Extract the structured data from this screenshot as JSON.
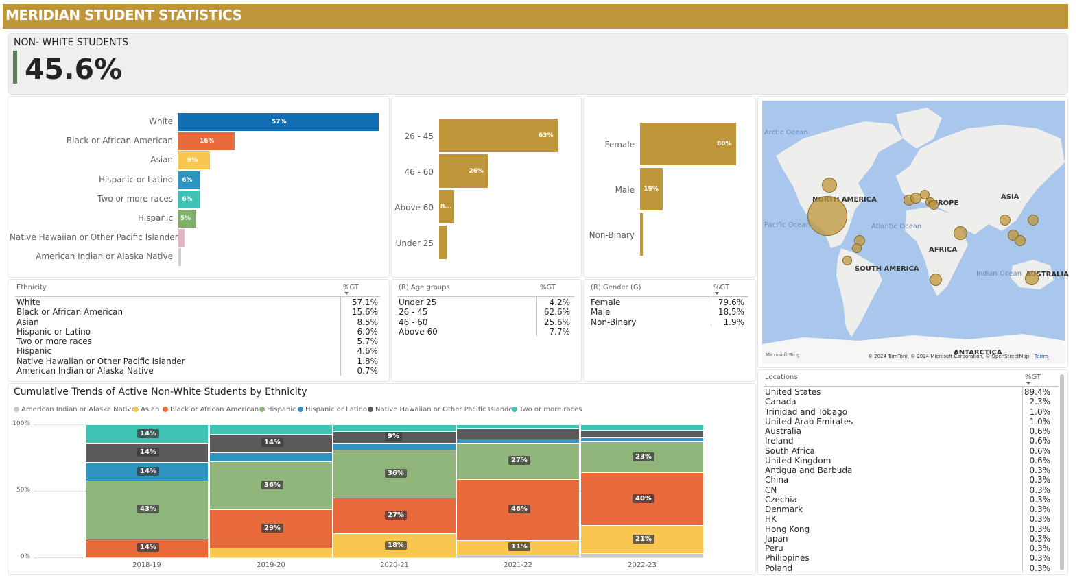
{
  "header": {
    "title": "MERIDIAN STUDENT STATISTICS"
  },
  "kpi": {
    "label": "NON- WHITE STUDENTS",
    "value": "45.6%",
    "accent_color": "#5f7e5c"
  },
  "ethnicity_bar": {
    "items": [
      {
        "label": "White",
        "value": 57,
        "text": "57%",
        "color": "#1170b5"
      },
      {
        "label": "Black or African American",
        "value": 16,
        "text": "16%",
        "color": "#e8693a"
      },
      {
        "label": "Asian",
        "value": 9,
        "text": "9%",
        "color": "#f9c74f"
      },
      {
        "label": "Hispanic or Latino",
        "value": 6,
        "text": "6%",
        "color": "#2e94c0"
      },
      {
        "label": "Two or more races",
        "value": 6,
        "text": "6%",
        "color": "#3fc2b4"
      },
      {
        "label": "Hispanic",
        "value": 5,
        "text": "5%",
        "color": "#7fae6a"
      },
      {
        "label": "Native Hawaiian or Other Pacific Islander",
        "value": 1.8,
        "text": "",
        "color": "#e3b7c2"
      },
      {
        "label": "American Indian or Alaska Native",
        "value": 0.7,
        "text": "",
        "color": "#d0d0d0"
      }
    ]
  },
  "age_bar": {
    "items": [
      {
        "label": "26 - 45",
        "value": 63,
        "text": "63%"
      },
      {
        "label": "46 - 60",
        "value": 26,
        "text": "26%"
      },
      {
        "label": "Above 60",
        "value": 8,
        "text": "8..."
      },
      {
        "label": "Under 25",
        "value": 4,
        "text": ""
      }
    ],
    "color": "#bf9539"
  },
  "gender_bar": {
    "items": [
      {
        "label": "Female",
        "value": 80,
        "text": "80%"
      },
      {
        "label": "Male",
        "value": 19,
        "text": "19%"
      },
      {
        "label": "Non-Binary",
        "value": 2,
        "text": ""
      }
    ],
    "color": "#bf9539"
  },
  "ethnicity_table": {
    "col1": "Ethnicity",
    "col2": "%GT",
    "rows": [
      [
        "White",
        "57.1%"
      ],
      [
        "Black or African American",
        "15.6%"
      ],
      [
        "Asian",
        "8.5%"
      ],
      [
        "Hispanic or Latino",
        "6.0%"
      ],
      [
        "Two or more races",
        "5.7%"
      ],
      [
        "Hispanic",
        "4.6%"
      ],
      [
        "Native Hawaiian or Other Pacific Islander",
        "1.8%"
      ],
      [
        "American Indian or Alaska Native",
        "0.7%"
      ]
    ]
  },
  "age_table": {
    "col1": "(R) Age groups",
    "col2": "%GT",
    "rows": [
      [
        "Under 25",
        "4.2%"
      ],
      [
        "26 - 45",
        "62.6%"
      ],
      [
        "46 - 60",
        "25.6%"
      ],
      [
        "Above 60",
        "7.7%"
      ]
    ]
  },
  "gender_table": {
    "col1": "(R) Gender (G)",
    "col2": "%GT",
    "rows": [
      [
        "Female",
        "79.6%"
      ],
      [
        "Male",
        "18.5%"
      ],
      [
        "Non-Binary",
        "1.9%"
      ]
    ]
  },
  "map": {
    "continents": [
      "NORTH AMERICA",
      "EUROPE",
      "ASIA",
      "AFRICA",
      "SOUTH AMERICA",
      "AUSTRALIA",
      "ANTARCTICA"
    ],
    "oceans": [
      "Arctic Ocean",
      "Pacific Ocean",
      "Atlantic Ocean",
      "Indian Ocean"
    ],
    "attribution": "© 2024 TomTom, © 2024 Microsoft Corporation, © OpenStreetMap",
    "terms": "Terms",
    "brand": "Microsoft Bing",
    "bubble_color": "#bf9539"
  },
  "locations_table": {
    "col1": "Locations",
    "col2": "%GT",
    "rows": [
      [
        "United States",
        "89.4%"
      ],
      [
        "Canada",
        "2.3%"
      ],
      [
        "Trinidad and Tobago",
        "1.0%"
      ],
      [
        "United Arab Emirates",
        "1.0%"
      ],
      [
        "Australia",
        "0.6%"
      ],
      [
        "Ireland",
        "0.6%"
      ],
      [
        "South Africa",
        "0.6%"
      ],
      [
        "United Kingdom",
        "0.6%"
      ],
      [
        "Antigua and Barbuda",
        "0.3%"
      ],
      [
        "China",
        "0.3%"
      ],
      [
        "CN",
        "0.3%"
      ],
      [
        "Czechia",
        "0.3%"
      ],
      [
        "Denmark",
        "0.3%"
      ],
      [
        "HK",
        "0.3%"
      ],
      [
        "Hong Kong",
        "0.3%"
      ],
      [
        "Japan",
        "0.3%"
      ],
      [
        "Peru",
        "0.3%"
      ],
      [
        "Philippines",
        "0.3%"
      ],
      [
        "Poland",
        "0.3%"
      ]
    ]
  },
  "chart_data": {
    "type": "bar",
    "stacked": "100%",
    "title": "Cumulative Trends of Active Non-White Students by Ethnicity",
    "categories": [
      "2018-19",
      "2019-20",
      "2020-21",
      "2021-22",
      "2022-23"
    ],
    "y_ticks": [
      "100%",
      "50%",
      "0%"
    ],
    "ylim": [
      0,
      100
    ],
    "legend_position": "top-left",
    "series": [
      {
        "name": "American Indian or Alaska Native",
        "color": "#c8c8c8",
        "values": [
          0,
          0,
          0,
          2,
          3
        ]
      },
      {
        "name": "Asian",
        "color": "#f9c74f",
        "values": [
          0,
          7,
          18,
          11,
          21
        ]
      },
      {
        "name": "Black or African American",
        "color": "#e8693a",
        "values": [
          14,
          29,
          27,
          46,
          40
        ]
      },
      {
        "name": "Hispanic",
        "color": "#8fb57a",
        "values": [
          43,
          36,
          36,
          27,
          23
        ]
      },
      {
        "name": "Hispanic or Latino",
        "color": "#2e94c0",
        "values": [
          14,
          7,
          5,
          3,
          3
        ]
      },
      {
        "name": "Native Hawaiian or Other Pacific Islander",
        "color": "#5a5a5a",
        "values": [
          14,
          14,
          9,
          8,
          6
        ]
      },
      {
        "name": "Two or more races",
        "color": "#3fc2b4",
        "values": [
          14,
          7,
          5,
          3,
          4
        ]
      }
    ],
    "data_labels": [
      [
        "",
        "",
        "14%",
        "43%",
        "14%",
        "14%",
        "14%"
      ],
      [
        "",
        "",
        "29%",
        "36%",
        "",
        "14%",
        ""
      ],
      [
        "",
        "18%",
        "27%",
        "36%",
        "",
        "9%",
        ""
      ],
      [
        "",
        "11%",
        "46%",
        "27%",
        "",
        "",
        ""
      ],
      [
        "",
        "21%",
        "40%",
        "23%",
        "",
        "",
        ""
      ]
    ]
  }
}
